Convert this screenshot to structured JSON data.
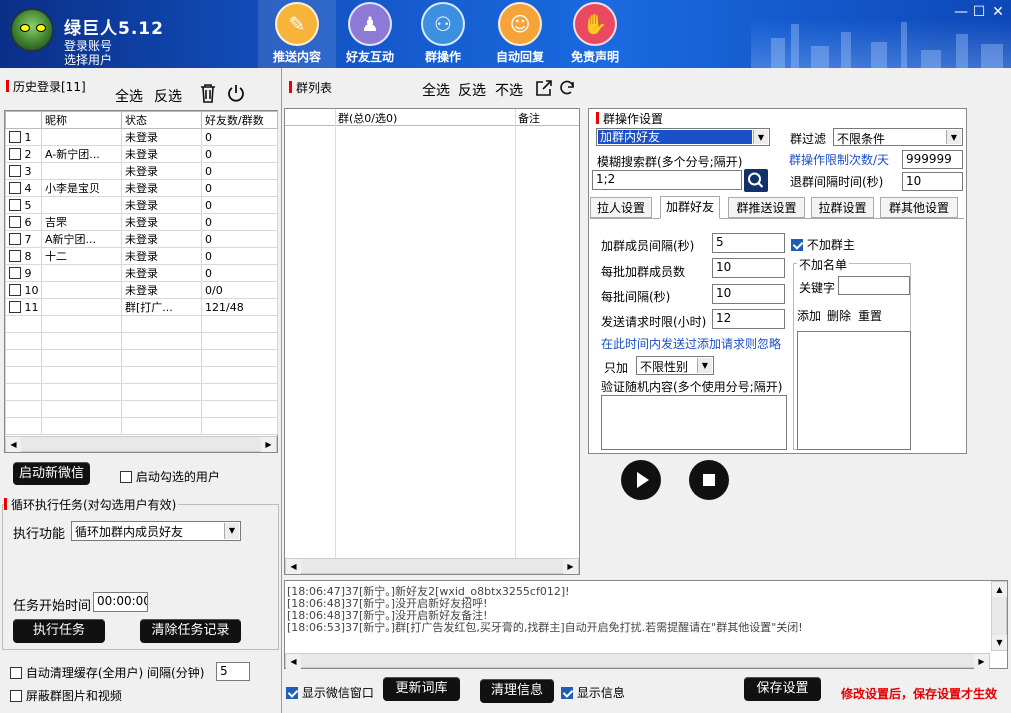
{
  "app": {
    "title": "绿巨人5.12",
    "account_label": "登录账号",
    "select_user_label": "选择用户"
  },
  "nav": [
    {
      "label": "推送内容",
      "icon": "edit-icon",
      "color": "#f6b53a"
    },
    {
      "label": "好友互动",
      "icon": "user-icon",
      "color": "#8c7ad6"
    },
    {
      "label": "群操作",
      "icon": "network-icon",
      "color": "#3d8fe0"
    },
    {
      "label": "自动回复",
      "icon": "users-icon",
      "color": "#f6a33a"
    },
    {
      "label": "免责声明",
      "icon": "shield-icon",
      "color": "#e94a62"
    }
  ],
  "history": {
    "title": "历史登录[11]",
    "select_all": "全选",
    "invert": "反选",
    "columns": [
      "昵称",
      "状态",
      "好友数/群数"
    ],
    "rows": [
      {
        "no": "1",
        "nick": "",
        "status": "未登录",
        "count": "0"
      },
      {
        "no": "2",
        "nick": "A-新宁团...",
        "status": "未登录",
        "count": "0"
      },
      {
        "no": "3",
        "nick": "",
        "status": "未登录",
        "count": "0"
      },
      {
        "no": "4",
        "nick": "小李是宝贝",
        "status": "未登录",
        "count": "0"
      },
      {
        "no": "5",
        "nick": "",
        "status": "未登录",
        "count": "0"
      },
      {
        "no": "6",
        "nick": "吉罘",
        "status": "未登录",
        "count": "0"
      },
      {
        "no": "7",
        "nick": "A新宁团...",
        "status": "未登录",
        "count": "0"
      },
      {
        "no": "8",
        "nick": "十二",
        "status": "未登录",
        "count": "0"
      },
      {
        "no": "9",
        "nick": "",
        "status": "未登录",
        "count": "0"
      },
      {
        "no": "10",
        "nick": "",
        "status": "未登录",
        "count": "0/0"
      },
      {
        "no": "11",
        "nick": "",
        "status": "群[打广...",
        "count": "121/48"
      }
    ],
    "start_wechat": "启动新微信",
    "start_checked": "启动勾选的用户"
  },
  "loop": {
    "title": "循环执行任务(对勾选用户有效)",
    "func_label": "执行功能",
    "func_value": "循环加群内成员好友",
    "start_time_label": "任务开始时间",
    "start_time": "00:00:00",
    "execute": "执行任务",
    "clear": "清除任务记录"
  },
  "bottom_left": {
    "auto_clear": "自动清理缓存(全用户)",
    "interval_label": "间隔(分钟)",
    "interval": "5",
    "block": "屏蔽群图片和视频"
  },
  "group_list": {
    "title": "群列表",
    "select_all": "全选",
    "invert": "反选",
    "deselect": "不选",
    "col_group": "群(总0/选0)",
    "col_note": "备注"
  },
  "settings": {
    "title": "群操作设置",
    "op_value": "加群内好友",
    "filter_label": "群过滤",
    "filter_value": "不限条件",
    "fuzzy_label": "模糊搜索群(多个分号;隔开)",
    "fuzzy_value": "1;2",
    "limit_label": "群操作限制次数/天",
    "limit_value": "999999",
    "quit_label": "退群间隔时间(秒)",
    "quit_value": "10",
    "tabs": [
      "拉人设置",
      "加群好友",
      "群推送设置",
      "拉群设置",
      "群其他设置"
    ],
    "member_interval_label": "加群成员间隔(秒)",
    "member_interval": "5",
    "no_owner": "不加群主",
    "batch_label": "每批加群成员数",
    "batch": "10",
    "batch_interval_label": "每批间隔(秒)",
    "batch_interval": "10",
    "req_limit_label": "发送请求时限(小时)",
    "req_limit": "12",
    "ignore_note": "在此时间内发送过添加请求则忽略",
    "only_label": "只加",
    "gender": "不限性别",
    "verify_label": "验证随机内容(多个使用分号;隔开)",
    "blacklist_title": "不加名单",
    "keyword_label": "关键字",
    "bl_add": "添加",
    "bl_delete": "删除",
    "bl_reset": "重置"
  },
  "logs": [
    "[18:06:47]37[新宁。]新好友2[wxid_o8btx3255cf012]!",
    "[18:06:48]37[新宁。]没开启新好友招呼!",
    "[18:06:48]37[新宁。]没开启新好友备注!",
    "[18:06:53]37[新宁。]群[打广告发红包,买牙膏的,找群主]自动开启免打扰.若需提醒请在\"群其他设置\"关闭!"
  ],
  "footer": {
    "show_window": "显示微信窗口",
    "update_lib": "更新词库",
    "clear_info": "清理信息",
    "show_info": "显示信息",
    "save": "保存设置",
    "warning": "修改设置后，保存设置才生效"
  },
  "colors": {
    "warning": "#e00000",
    "link_blue": "#1a50c8",
    "accent_red": "#e00000"
  }
}
